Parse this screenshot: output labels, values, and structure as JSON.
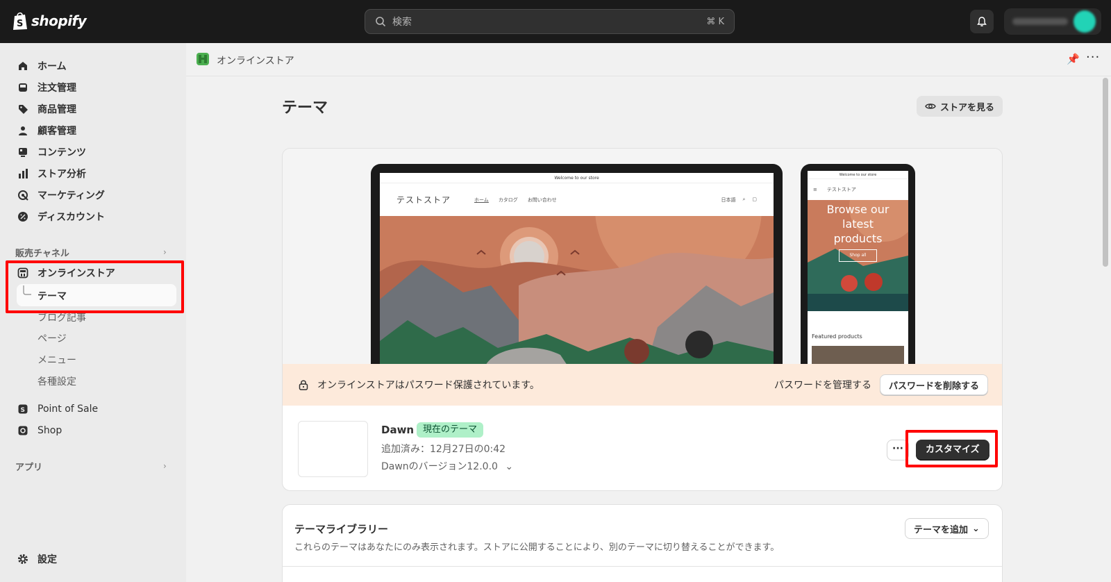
{
  "topbar": {
    "logo_text": "shopify",
    "search_placeholder": "検索",
    "search_shortcut": "⌘ K"
  },
  "sidebar": {
    "items": [
      {
        "label": "ホーム",
        "icon": "home-icon"
      },
      {
        "label": "注文管理",
        "icon": "inbox-icon"
      },
      {
        "label": "商品管理",
        "icon": "tag-icon"
      },
      {
        "label": "顧客管理",
        "icon": "person-icon"
      },
      {
        "label": "コンテンツ",
        "icon": "content-icon"
      },
      {
        "label": "ストア分析",
        "icon": "chart-bar-icon"
      },
      {
        "label": "マーケティング",
        "icon": "target-icon"
      },
      {
        "label": "ディスカウント",
        "icon": "discount-icon"
      }
    ],
    "sales_channels_label": "販売チャネル",
    "online_store_label": "オンラインストア",
    "sub_items": [
      "テーマ",
      "ブログ記事",
      "ページ",
      "メニュー",
      "各種設定"
    ],
    "pos_label": "Point of Sale",
    "shop_label": "Shop",
    "apps_label": "アプリ",
    "settings_label": "設定"
  },
  "breadcrumb": {
    "label": "オンラインストア"
  },
  "page": {
    "title": "テーマ",
    "view_store_label": "ストアを見る"
  },
  "preview": {
    "announcement": "Welcome to our store",
    "store_name": "テストストア",
    "nav_links": [
      "ホーム",
      "カタログ",
      "お問い合わせ"
    ],
    "language": "日本語",
    "mobile_hero": [
      "Browse our",
      "latest",
      "products"
    ],
    "shop_all": "Shop all",
    "featured_products": "Featured products"
  },
  "banner": {
    "text": "オンラインストアはパスワード保護されています。",
    "manage_link": "パスワードを管理する",
    "remove_button": "パスワードを削除する"
  },
  "current_theme": {
    "name": "Dawn",
    "badge": "現在のテーマ",
    "added": "追加済み：12月27日の0:42",
    "version": "Dawnのバージョン12.0.0",
    "more_label": "···",
    "customize_label": "カスタマイズ"
  },
  "library": {
    "title": "テーマライブラリー",
    "description": "これらのテーマはあなたにのみ表示されます。ストアに公開することにより、別のテーマに切り替えることができます。",
    "add_theme_label": "テーマを追加"
  },
  "colors": {
    "topbar": "#1a1a1a",
    "highlight": "#ff0000",
    "badge_bg": "#aff0c8",
    "banner_bg": "#fdeadb"
  }
}
